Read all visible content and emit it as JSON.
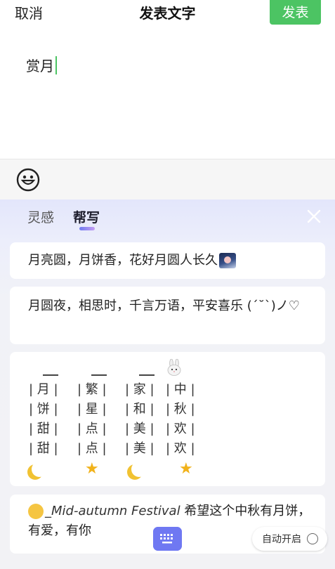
{
  "header": {
    "cancel_label": "取消",
    "title": "发表文字",
    "publish_label": "发表"
  },
  "editor": {
    "text": "赏月"
  },
  "emoji_bar": {
    "icon": "smiley-icon"
  },
  "assistant": {
    "tabs": [
      {
        "label": "灵感",
        "active": false
      },
      {
        "label": "帮写",
        "active": true
      }
    ],
    "close_icon": "close-icon",
    "suggestions": [
      {
        "text": "月亮圆，月饼香，花好月圆人长久",
        "emoji": "moon-photo-emoji"
      },
      {
        "text": "月圆夜，相思时，千言万语，平安喜乐 (ˊ˘ˋ)ノ♡"
      },
      {
        "columns": [
          [
            "月",
            "饼",
            "甜",
            "甜"
          ],
          [
            "繁",
            "星",
            "点",
            "点"
          ],
          [
            "家",
            "和",
            "美",
            "美"
          ],
          [
            "中",
            "秋",
            "欢",
            "欢"
          ]
        ],
        "decorations": [
          "crescent-moon-emoji",
          "star-emoji",
          "crescent-moon-emoji",
          "star-emoji"
        ],
        "top_emoji": "rabbit-emoji"
      },
      {
        "emoji": "full-moon-emoji",
        "text_prefix": "_Mid-autumn Festival",
        "text": " 希望这个中秋有月饼，有爱，有你"
      }
    ]
  },
  "footer": {
    "keyboard_icon": "keyboard-icon",
    "auto_open_label": "自动开启"
  },
  "colors": {
    "accent_green": "#4cc463",
    "accent_purple": "#6f7cf0"
  }
}
